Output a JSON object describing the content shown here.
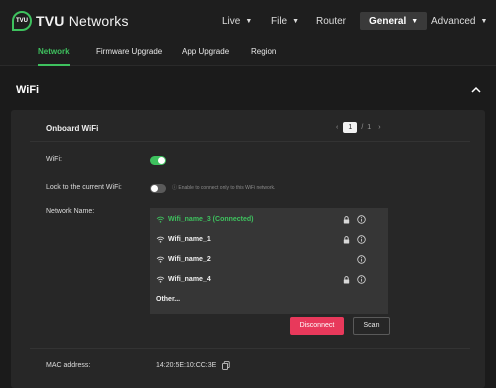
{
  "brand": {
    "badge": "TVU",
    "name_bold": "TVU",
    "name_rest": " Networks"
  },
  "top_menu": [
    {
      "label": "Live",
      "caret": "▼"
    },
    {
      "label": "File",
      "caret": "▼"
    },
    {
      "label": "Router",
      "caret": ""
    },
    {
      "label": "General",
      "caret": "▼"
    },
    {
      "label": "Advanced",
      "caret": "▼"
    }
  ],
  "sub_tabs": [
    "Network",
    "Firmware Upgrade",
    "App Upgrade",
    "Region"
  ],
  "section": {
    "title": "WiFi"
  },
  "card": {
    "title": "Onboard WiFi",
    "pager": {
      "prev": "‹",
      "current": "1",
      "sep": "/",
      "total": "1",
      "next": "›"
    }
  },
  "wifi_toggle": {
    "label": "WiFi:",
    "state": "on"
  },
  "lock_toggle": {
    "label": "Lock to the current WiFi:",
    "state": "off",
    "hint": "Enable to connect only to this WiFi network."
  },
  "network": {
    "label": "Network Name:",
    "items": [
      {
        "name": "Wifi_name_3 (Connected)",
        "connected": true,
        "locked": true
      },
      {
        "name": "Wifi_name_1",
        "connected": false,
        "locked": true
      },
      {
        "name": "Wifi_name_2",
        "connected": false,
        "locked": false
      },
      {
        "name": "Wifi_name_4",
        "connected": false,
        "locked": true
      }
    ],
    "other": "Other..."
  },
  "buttons": {
    "disconnect": "Disconnect",
    "scan": "Scan"
  },
  "mac": {
    "label": "MAC address:",
    "value": "14:20:5E:10:CC:3E"
  },
  "colors": {
    "accent": "#3ec15e",
    "danger": "#e8395b",
    "background": "#1b1b1b",
    "panel": "#272727"
  }
}
